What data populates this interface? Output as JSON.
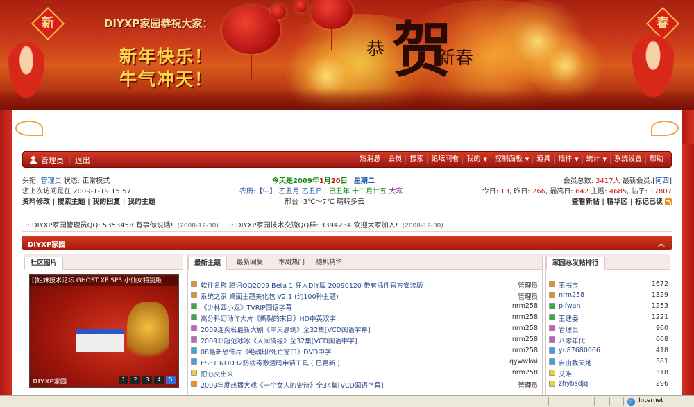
{
  "banner": {
    "title": "DIYXP家园恭祝大家：",
    "slogan_line1": "新年快乐！",
    "slogan_line2": "牛气冲天！",
    "fu_left": "新",
    "fu_right": "春",
    "big_char": "贺",
    "small_left": "恭",
    "small_right": "新春"
  },
  "nav": {
    "user": "管理员",
    "logout": "退出",
    "items": [
      "短消息",
      "会员",
      "搜索",
      "论坛问卷",
      "我的",
      "控制面板",
      "道具",
      "插件",
      "统计",
      "系统设置",
      "帮助"
    ],
    "dropdown_items": [
      "我的",
      "控制面板",
      "插件",
      "统计"
    ]
  },
  "info": {
    "head_label": "头衔:",
    "head_value": "管理员",
    "status_label": "状态:",
    "status_value": "正常模式",
    "last_visit_label": "您上次访问是在",
    "last_visit_value": "2009-1-19 15:57",
    "links": [
      "资料修改",
      "搜索主题",
      "我的回复",
      "我的主题"
    ],
    "today_prefix": "今天是",
    "today_year": "2009",
    "today_y_unit": "年",
    "today_month": "1",
    "today_m_unit": "月",
    "today_day": "20",
    "today_d_unit": "日",
    "weekday": "星期二",
    "lunar_label": "农历:",
    "lunar_bracket_open": "【",
    "lunar_ox": "牛",
    "lunar_bracket_close": "】",
    "lunar_year": "乙丑月",
    "lunar_day": "乙丑日",
    "lunar_time": "己丑年",
    "lunar_date": "十二月廿五",
    "solar_term": "大寒",
    "weather": "邢台 -3℃～7℃ 晴转多云",
    "members_label": "会员总数:",
    "members_value": "3417人",
    "newest_label": "最新会员:",
    "newest_open": "[",
    "newest_value": "阿四",
    "newest_close": "]",
    "today_stats_label": "今日:",
    "today_stats_value": "13",
    "yesterday_label": "昨日:",
    "yesterday_value": "266",
    "max_label": "最高日:",
    "max_value": "642",
    "topics_label": "主题:",
    "topics_value": "4685",
    "posts_label": "帖子:",
    "posts_value": "17807",
    "right_links": [
      "查看新帖",
      "精华区",
      "标记已读"
    ]
  },
  "notices": [
    {
      "text": "DIYXP家园管理员QQ: 5353458 有事你说话!",
      "date": "(2008-12-30)"
    },
    {
      "text": "DIYXP家园技术交流QQ群: 3394234 欢迎大家加入!",
      "date": "(2008-12-30)"
    }
  ],
  "section": {
    "title": "DIYXP家园",
    "chevron": "︽"
  },
  "photo_panel": {
    "tab": "社区图片",
    "caption": "[]姐妹技术论坛 GHOST XP SP3 小仙女特别版",
    "watermark": "DIYXP家园",
    "pages": [
      "1",
      "2",
      "3",
      "4",
      "5"
    ]
  },
  "topics_panel": {
    "tabs": [
      "最新主题",
      "最新回复",
      "本周热门",
      "随机精华"
    ],
    "rows": [
      {
        "title": "软件名称 腾讯QQ2009 Beta 1 狂人DIY版 20090120 带有插件官方安装版",
        "author": "管理员",
        "color": "#f09018"
      },
      {
        "title": "系统之家 桌面主题美化包 V2.1 (约100种主题)",
        "author": "管理员",
        "color": "#f09018"
      },
      {
        "title": "《少林四小龙》TVRIP国语字幕",
        "author": "nrm258",
        "color": "#40a840"
      },
      {
        "title": "高分科幻动作大片《撕裂的末日》HD中英双字",
        "author": "nrm258",
        "color": "#40a840"
      },
      {
        "title": "2009连奕名最新大剧《中天悬剑》全32集[VCD国语字幕]",
        "author": "nrm258",
        "color": "#c060c0"
      },
      {
        "title": "2009邓超范冰冰《人间情缘》全32集[VCD国语中字]",
        "author": "nrm258",
        "color": "#c060c0"
      },
      {
        "title": "08最新恐怖片《绝魂印/死亡窗口》DVD中字",
        "author": "nrm258",
        "color": "#40a0e0"
      },
      {
        "title": "ESET NOD32防病毒激活码申请工具 ( 已更新 )",
        "author": "qywwkai",
        "color": "#40a0e0"
      },
      {
        "title": "把心交出来",
        "author": "nrm258",
        "color": "#f0d040"
      },
      {
        "title": "2009年度热播大戏《一个女人的史诗》全34集[VCD国语字幕]",
        "author": "管理员",
        "color": "#f09018"
      }
    ]
  },
  "rank_panel": {
    "tab": "家园总发帖排行",
    "rows": [
      {
        "name": "王书宝",
        "count": "1672",
        "color": "#f09018"
      },
      {
        "name": "nrm258",
        "count": "1329",
        "color": "#f09018"
      },
      {
        "name": "pjfwan",
        "count": "1253",
        "color": "#40a840"
      },
      {
        "name": "王建委",
        "count": "1221",
        "color": "#40a840"
      },
      {
        "name": "管理员",
        "count": "960",
        "color": "#c060c0"
      },
      {
        "name": "八零年代",
        "count": "608",
        "color": "#c060c0"
      },
      {
        "name": "yu87680066",
        "count": "418",
        "color": "#40a0e0"
      },
      {
        "name": "自由我天地",
        "count": "381",
        "color": "#40a0e0"
      },
      {
        "name": "艾唯",
        "count": "318",
        "color": "#f0d040"
      },
      {
        "name": "zhybsdjq",
        "count": "296",
        "color": "#f0d040"
      }
    ]
  },
  "statusbar": {
    "zone": "Internet"
  }
}
